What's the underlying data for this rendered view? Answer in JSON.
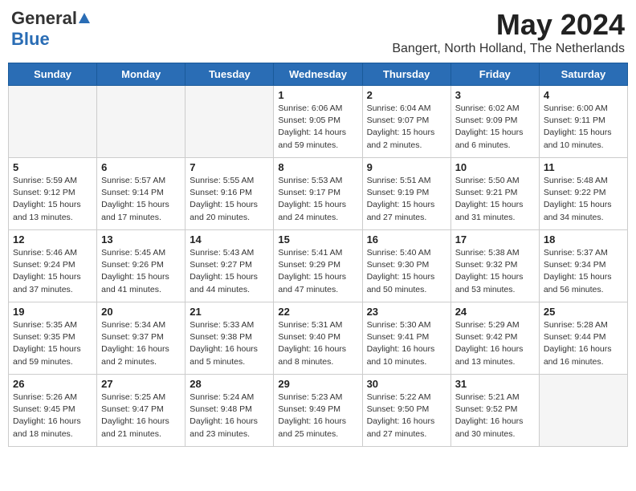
{
  "header": {
    "logo_general": "General",
    "logo_blue": "Blue",
    "month_title": "May 2024",
    "location": "Bangert, North Holland, The Netherlands"
  },
  "days_of_week": [
    "Sunday",
    "Monday",
    "Tuesday",
    "Wednesday",
    "Thursday",
    "Friday",
    "Saturday"
  ],
  "weeks": [
    [
      {
        "day": "",
        "info": ""
      },
      {
        "day": "",
        "info": ""
      },
      {
        "day": "",
        "info": ""
      },
      {
        "day": "1",
        "info": "Sunrise: 6:06 AM\nSunset: 9:05 PM\nDaylight: 14 hours\nand 59 minutes."
      },
      {
        "day": "2",
        "info": "Sunrise: 6:04 AM\nSunset: 9:07 PM\nDaylight: 15 hours\nand 2 minutes."
      },
      {
        "day": "3",
        "info": "Sunrise: 6:02 AM\nSunset: 9:09 PM\nDaylight: 15 hours\nand 6 minutes."
      },
      {
        "day": "4",
        "info": "Sunrise: 6:00 AM\nSunset: 9:11 PM\nDaylight: 15 hours\nand 10 minutes."
      }
    ],
    [
      {
        "day": "5",
        "info": "Sunrise: 5:59 AM\nSunset: 9:12 PM\nDaylight: 15 hours\nand 13 minutes."
      },
      {
        "day": "6",
        "info": "Sunrise: 5:57 AM\nSunset: 9:14 PM\nDaylight: 15 hours\nand 17 minutes."
      },
      {
        "day": "7",
        "info": "Sunrise: 5:55 AM\nSunset: 9:16 PM\nDaylight: 15 hours\nand 20 minutes."
      },
      {
        "day": "8",
        "info": "Sunrise: 5:53 AM\nSunset: 9:17 PM\nDaylight: 15 hours\nand 24 minutes."
      },
      {
        "day": "9",
        "info": "Sunrise: 5:51 AM\nSunset: 9:19 PM\nDaylight: 15 hours\nand 27 minutes."
      },
      {
        "day": "10",
        "info": "Sunrise: 5:50 AM\nSunset: 9:21 PM\nDaylight: 15 hours\nand 31 minutes."
      },
      {
        "day": "11",
        "info": "Sunrise: 5:48 AM\nSunset: 9:22 PM\nDaylight: 15 hours\nand 34 minutes."
      }
    ],
    [
      {
        "day": "12",
        "info": "Sunrise: 5:46 AM\nSunset: 9:24 PM\nDaylight: 15 hours\nand 37 minutes."
      },
      {
        "day": "13",
        "info": "Sunrise: 5:45 AM\nSunset: 9:26 PM\nDaylight: 15 hours\nand 41 minutes."
      },
      {
        "day": "14",
        "info": "Sunrise: 5:43 AM\nSunset: 9:27 PM\nDaylight: 15 hours\nand 44 minutes."
      },
      {
        "day": "15",
        "info": "Sunrise: 5:41 AM\nSunset: 9:29 PM\nDaylight: 15 hours\nand 47 minutes."
      },
      {
        "day": "16",
        "info": "Sunrise: 5:40 AM\nSunset: 9:30 PM\nDaylight: 15 hours\nand 50 minutes."
      },
      {
        "day": "17",
        "info": "Sunrise: 5:38 AM\nSunset: 9:32 PM\nDaylight: 15 hours\nand 53 minutes."
      },
      {
        "day": "18",
        "info": "Sunrise: 5:37 AM\nSunset: 9:34 PM\nDaylight: 15 hours\nand 56 minutes."
      }
    ],
    [
      {
        "day": "19",
        "info": "Sunrise: 5:35 AM\nSunset: 9:35 PM\nDaylight: 15 hours\nand 59 minutes."
      },
      {
        "day": "20",
        "info": "Sunrise: 5:34 AM\nSunset: 9:37 PM\nDaylight: 16 hours\nand 2 minutes."
      },
      {
        "day": "21",
        "info": "Sunrise: 5:33 AM\nSunset: 9:38 PM\nDaylight: 16 hours\nand 5 minutes."
      },
      {
        "day": "22",
        "info": "Sunrise: 5:31 AM\nSunset: 9:40 PM\nDaylight: 16 hours\nand 8 minutes."
      },
      {
        "day": "23",
        "info": "Sunrise: 5:30 AM\nSunset: 9:41 PM\nDaylight: 16 hours\nand 10 minutes."
      },
      {
        "day": "24",
        "info": "Sunrise: 5:29 AM\nSunset: 9:42 PM\nDaylight: 16 hours\nand 13 minutes."
      },
      {
        "day": "25",
        "info": "Sunrise: 5:28 AM\nSunset: 9:44 PM\nDaylight: 16 hours\nand 16 minutes."
      }
    ],
    [
      {
        "day": "26",
        "info": "Sunrise: 5:26 AM\nSunset: 9:45 PM\nDaylight: 16 hours\nand 18 minutes."
      },
      {
        "day": "27",
        "info": "Sunrise: 5:25 AM\nSunset: 9:47 PM\nDaylight: 16 hours\nand 21 minutes."
      },
      {
        "day": "28",
        "info": "Sunrise: 5:24 AM\nSunset: 9:48 PM\nDaylight: 16 hours\nand 23 minutes."
      },
      {
        "day": "29",
        "info": "Sunrise: 5:23 AM\nSunset: 9:49 PM\nDaylight: 16 hours\nand 25 minutes."
      },
      {
        "day": "30",
        "info": "Sunrise: 5:22 AM\nSunset: 9:50 PM\nDaylight: 16 hours\nand 27 minutes."
      },
      {
        "day": "31",
        "info": "Sunrise: 5:21 AM\nSunset: 9:52 PM\nDaylight: 16 hours\nand 30 minutes."
      },
      {
        "day": "",
        "info": ""
      }
    ]
  ]
}
